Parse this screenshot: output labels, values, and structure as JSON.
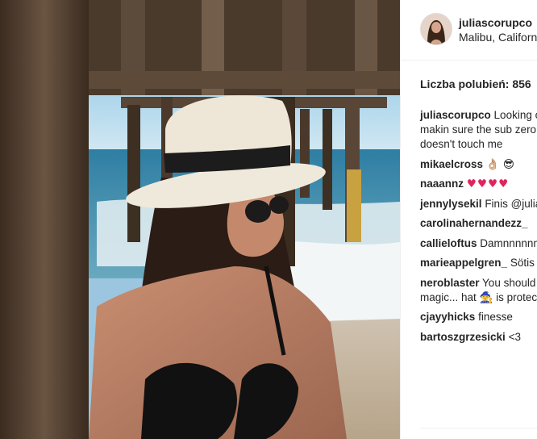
{
  "post": {
    "username": "juliascorupco",
    "location": "Malibu, California",
    "likes_label": "Liczba polubień: 856"
  },
  "caption": {
    "author": "juliascorupco",
    "text": "Looking out & makin sure the sub zero doesn't touch me"
  },
  "comments": [
    {
      "author": "mikaelcross",
      "text": "",
      "emoji": "👌🏼 😎"
    },
    {
      "author": "naaannz",
      "text": "",
      "emoji": "♥♥♥♥"
    },
    {
      "author": "jennylysekil",
      "text": "Finis @julia"
    },
    {
      "author": "carolinahernandezz_",
      "text": ""
    },
    {
      "author": "callieloftus",
      "text": "Damnnnnnn"
    },
    {
      "author": "marieappelgren_",
      "text": "Sötis"
    },
    {
      "author": "neroblaster",
      "text": "You should",
      "text2": "magic... hat 🧙 is protected"
    },
    {
      "author": "cjayyhicks",
      "text": "finesse"
    },
    {
      "author": "bartoszgrzesicki",
      "text": "<3"
    }
  ],
  "colors": {
    "text": "#262626",
    "heart": "#e0245e",
    "divider": "#efefef"
  }
}
